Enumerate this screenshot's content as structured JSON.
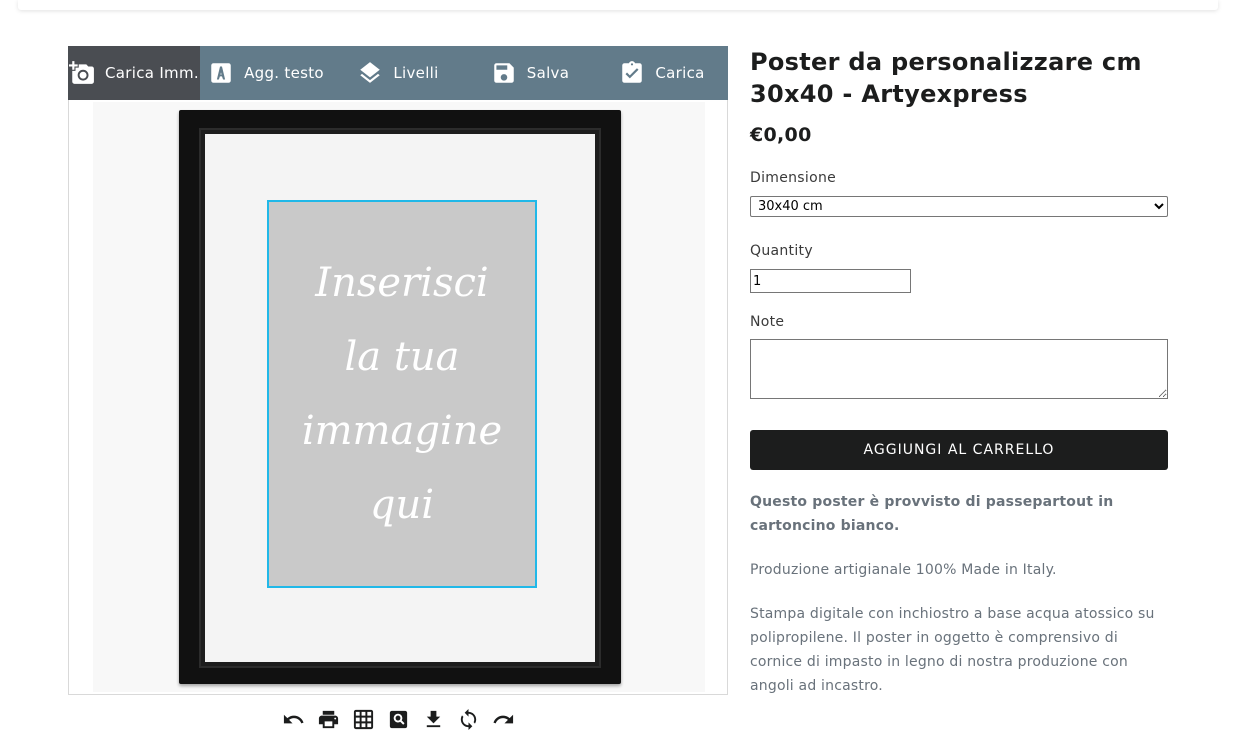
{
  "toolbar": {
    "items": [
      {
        "label": "Carica Imm.",
        "icon": "add-photo-icon",
        "active": true
      },
      {
        "label": "Agg. testo",
        "icon": "text-icon",
        "active": false
      },
      {
        "label": "Livelli",
        "icon": "layers-icon",
        "active": false
      },
      {
        "label": "Salva",
        "icon": "save-icon",
        "active": false
      },
      {
        "label": "Carica",
        "icon": "clipboard-check-icon",
        "active": false
      }
    ]
  },
  "canvas": {
    "placeholder_lines": [
      "Inserisci",
      "la tua",
      "immagine",
      "qui"
    ]
  },
  "bottom_tools": [
    "undo-icon",
    "print-icon",
    "grid-icon",
    "preview-icon",
    "download-icon",
    "refresh-icon",
    "redo-icon"
  ],
  "product": {
    "title": "Poster da personalizzare cm 30x40 - Artyexpress",
    "price": "€0,00",
    "dimension_label": "Dimensione",
    "dimension_value": "30x40 cm",
    "quantity_label": "Quantity",
    "quantity_value": "1",
    "note_label": "Note",
    "note_value": "",
    "add_to_cart": "AGGIUNGI AL CARRELLO",
    "description": {
      "bold": "Questo poster è provvisto di passepartout in cartoncino bianco.",
      "p1": "Produzione artigianale 100% Made in Italy.",
      "p2": "Stampa digitale con inchiostro a base acqua atossico su polipropilene. Il poster in oggetto è comprensivo di cornice di impasto in legno di nostra produzione con angoli ad incastro."
    }
  },
  "colors": {
    "toolbar_bg": "#627b8a",
    "toolbar_active": "#4a4d52",
    "selection_border": "#20b8e8",
    "button_bg": "#1c1d1d"
  }
}
